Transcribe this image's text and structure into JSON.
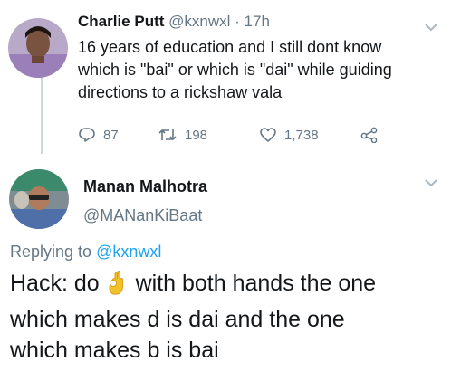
{
  "tweet1": {
    "name": "Charlie Putt",
    "handle": "@kxnwxl",
    "separator": "·",
    "time": "17h",
    "lines": [
      "16 years of education and I still dont know",
      "which is \"bai\" or which is \"dai\" while guiding",
      "directions to a rickshaw vala"
    ],
    "replies": "87",
    "retweets": "198",
    "likes": "1,738"
  },
  "tweet2": {
    "name": "Manan Malhotra",
    "handle": "@MANanKiBaat",
    "replying_prefix": "Replying to",
    "replying_to": "@kxnwxl",
    "line1_before": "Hack: do",
    "line1_after": "with both hands the one",
    "line2": "which makes d is dai and the one",
    "line3": "which makes b is bai",
    "emoji": "ok-hand-emoji"
  },
  "colors": {
    "text": "#14171a",
    "muted": "#657786",
    "link": "#1da1f2",
    "thread_line": "#ccd6dd"
  }
}
